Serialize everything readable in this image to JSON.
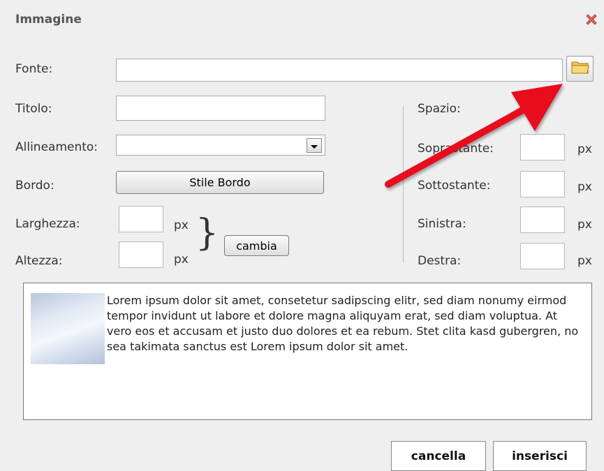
{
  "dialog": {
    "title": "Immagine",
    "close_icon": "close-x-icon"
  },
  "form": {
    "fonte_label": "Fonte:",
    "fonte_value": "",
    "folder_icon": "folder-icon",
    "titolo_label": "Titolo:",
    "titolo_value": "",
    "allineamento_label": "Allineamento:",
    "allineamento_value": "",
    "bordo_label": "Bordo:",
    "bordo_button": "Stile Bordo",
    "larghezza_label": "Larghezza:",
    "altezza_label": "Altezza:",
    "px": "px",
    "brace": "}",
    "cambia_button": "cambia"
  },
  "spacing": {
    "title": "Spazio:",
    "soprastante_label": "Soprastante:",
    "sottostante_label": "Sottostante:",
    "sinistra_label": "Sinistra:",
    "destra_label": "Destra:",
    "px": "px"
  },
  "preview": {
    "text": "Lorem ipsum dolor sit amet, consetetur sadipscing elitr, sed diam nonumy eirmod tempor invidunt ut labore et dolore magna aliquyam erat, sed diam voluptua. At vero eos et accusam et justo duo dolores et ea rebum. Stet clita kasd gubergren, no sea takimata sanctus est Lorem ipsum dolor sit amet."
  },
  "actions": {
    "cancel": "cancella",
    "insert": "inserisci"
  },
  "colors": {
    "arrow": "#e8101a",
    "close": "#d9534f",
    "folder": "#e8b437"
  }
}
